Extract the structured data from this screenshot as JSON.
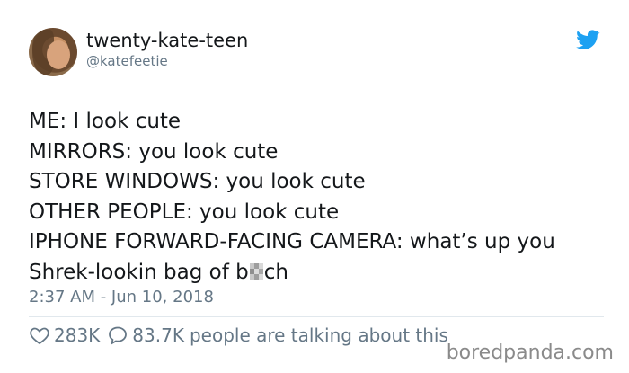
{
  "user": {
    "display_name": "twenty-kate-teen",
    "handle": "@katefeetie"
  },
  "tweet": {
    "lines": [
      "ME: I look cute",
      "MIRRORS: you look cute",
      "STORE WINDOWS: you look cute",
      "OTHER PEOPLE: you look cute",
      "IPHONE FORWARD-FACING CAMERA: what’s up you"
    ],
    "last_line_prefix": "Shrek-lookin bag of b",
    "last_line_suffix": "ch",
    "timestamp": "2:37 AM - Jun 10, 2018"
  },
  "actions": {
    "likes": "283K",
    "replies": "83.7K",
    "talking_label": "people are talking about this"
  },
  "watermark": "boredpanda.com",
  "colors": {
    "brand": "#1da1f2",
    "text": "#14171a",
    "muted": "#657786"
  },
  "icons": {
    "logo": "twitter-bird-icon",
    "like": "heart-icon",
    "reply": "speech-bubble-icon"
  }
}
